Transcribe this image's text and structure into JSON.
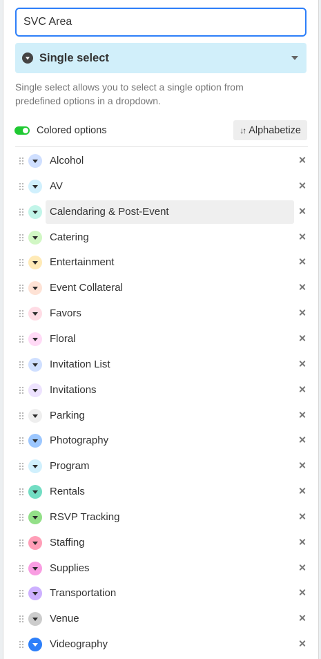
{
  "field_name": {
    "value": "SVC Area"
  },
  "field_type": {
    "label": "Single select",
    "icon": "single-select-icon"
  },
  "description": "Single select allows you to select a single option from predefined options in a dropdown.",
  "colored_options": {
    "label": "Colored options",
    "enabled": true,
    "color": "#20c933"
  },
  "alphabetize": {
    "label": "Alphabetize",
    "icon": "sort-icon"
  },
  "options": [
    {
      "name": "Alcohol",
      "color": "#cfdfff"
    },
    {
      "name": "AV",
      "color": "#d0f0fd"
    },
    {
      "name": "Calendaring & Post-Event",
      "color": "#c2f5e9"
    },
    {
      "name": "Catering",
      "color": "#d1f7c4"
    },
    {
      "name": "Entertainment",
      "color": "#ffeab6"
    },
    {
      "name": "Event Collateral",
      "color": "#fee2d5"
    },
    {
      "name": "Favors",
      "color": "#ffdce5"
    },
    {
      "name": "Floral",
      "color": "#ffdaf6"
    },
    {
      "name": "Invitation List",
      "color": "#cfdfff"
    },
    {
      "name": "Invitations",
      "color": "#ede2fe"
    },
    {
      "name": "Parking",
      "color": "#eeeeee"
    },
    {
      "name": "Photography",
      "color": "#9cc7ff"
    },
    {
      "name": "Program",
      "color": "#d0f0fd"
    },
    {
      "name": "Rentals",
      "color": "#72ddc3"
    },
    {
      "name": "RSVP Tracking",
      "color": "#93e088"
    },
    {
      "name": "Staffing",
      "color": "#ff9eb7"
    },
    {
      "name": "Supplies",
      "color": "#f99de2"
    },
    {
      "name": "Transportation",
      "color": "#cdb0ff"
    },
    {
      "name": "Venue",
      "color": "#cccccc"
    },
    {
      "name": "Videography",
      "color": "#2d7ff9"
    }
  ],
  "hovered_option": "Calendaring & Post-Event"
}
